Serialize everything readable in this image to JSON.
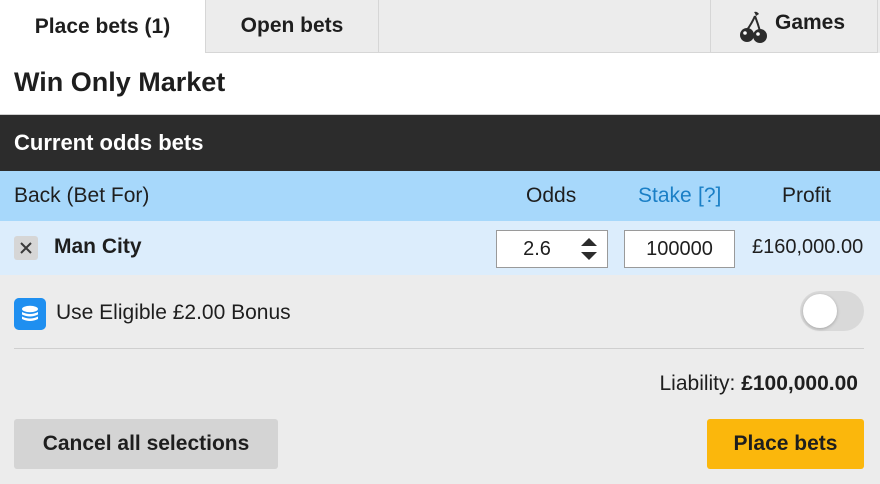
{
  "tabs": {
    "place_bets": "Place bets (1)",
    "open_bets": "Open bets",
    "games": "Games",
    "games_icon": "cherry-icon"
  },
  "market": {
    "title": "Win Only Market"
  },
  "section": {
    "title": "Current odds bets"
  },
  "columns": {
    "back": "Back (Bet For)",
    "odds": "Odds",
    "stake": "Stake",
    "stake_help": "[?]",
    "profit": "Profit"
  },
  "selection": {
    "name": "Man City",
    "odds": "2.6",
    "stake": "100000",
    "profit": "£160,000.00",
    "remove_icon": "close-icon",
    "stepper_icon": "up-down-arrows-icon"
  },
  "bonus": {
    "label": "Use Eligible £2.00 Bonus",
    "icon": "coins-icon",
    "enabled": false
  },
  "liability": {
    "label": "Liability:",
    "value": "£100,000.00"
  },
  "buttons": {
    "cancel_all": "Cancel all selections",
    "place_bets": "Place bets"
  },
  "colors": {
    "header_dark": "#2c2c2c",
    "column_header": "#a7d8fb",
    "selection_row": "#dcedfc",
    "stake_link": "#1a7fc6",
    "place_button": "#fbb70c",
    "bonus_icon": "#1f8ff0"
  }
}
